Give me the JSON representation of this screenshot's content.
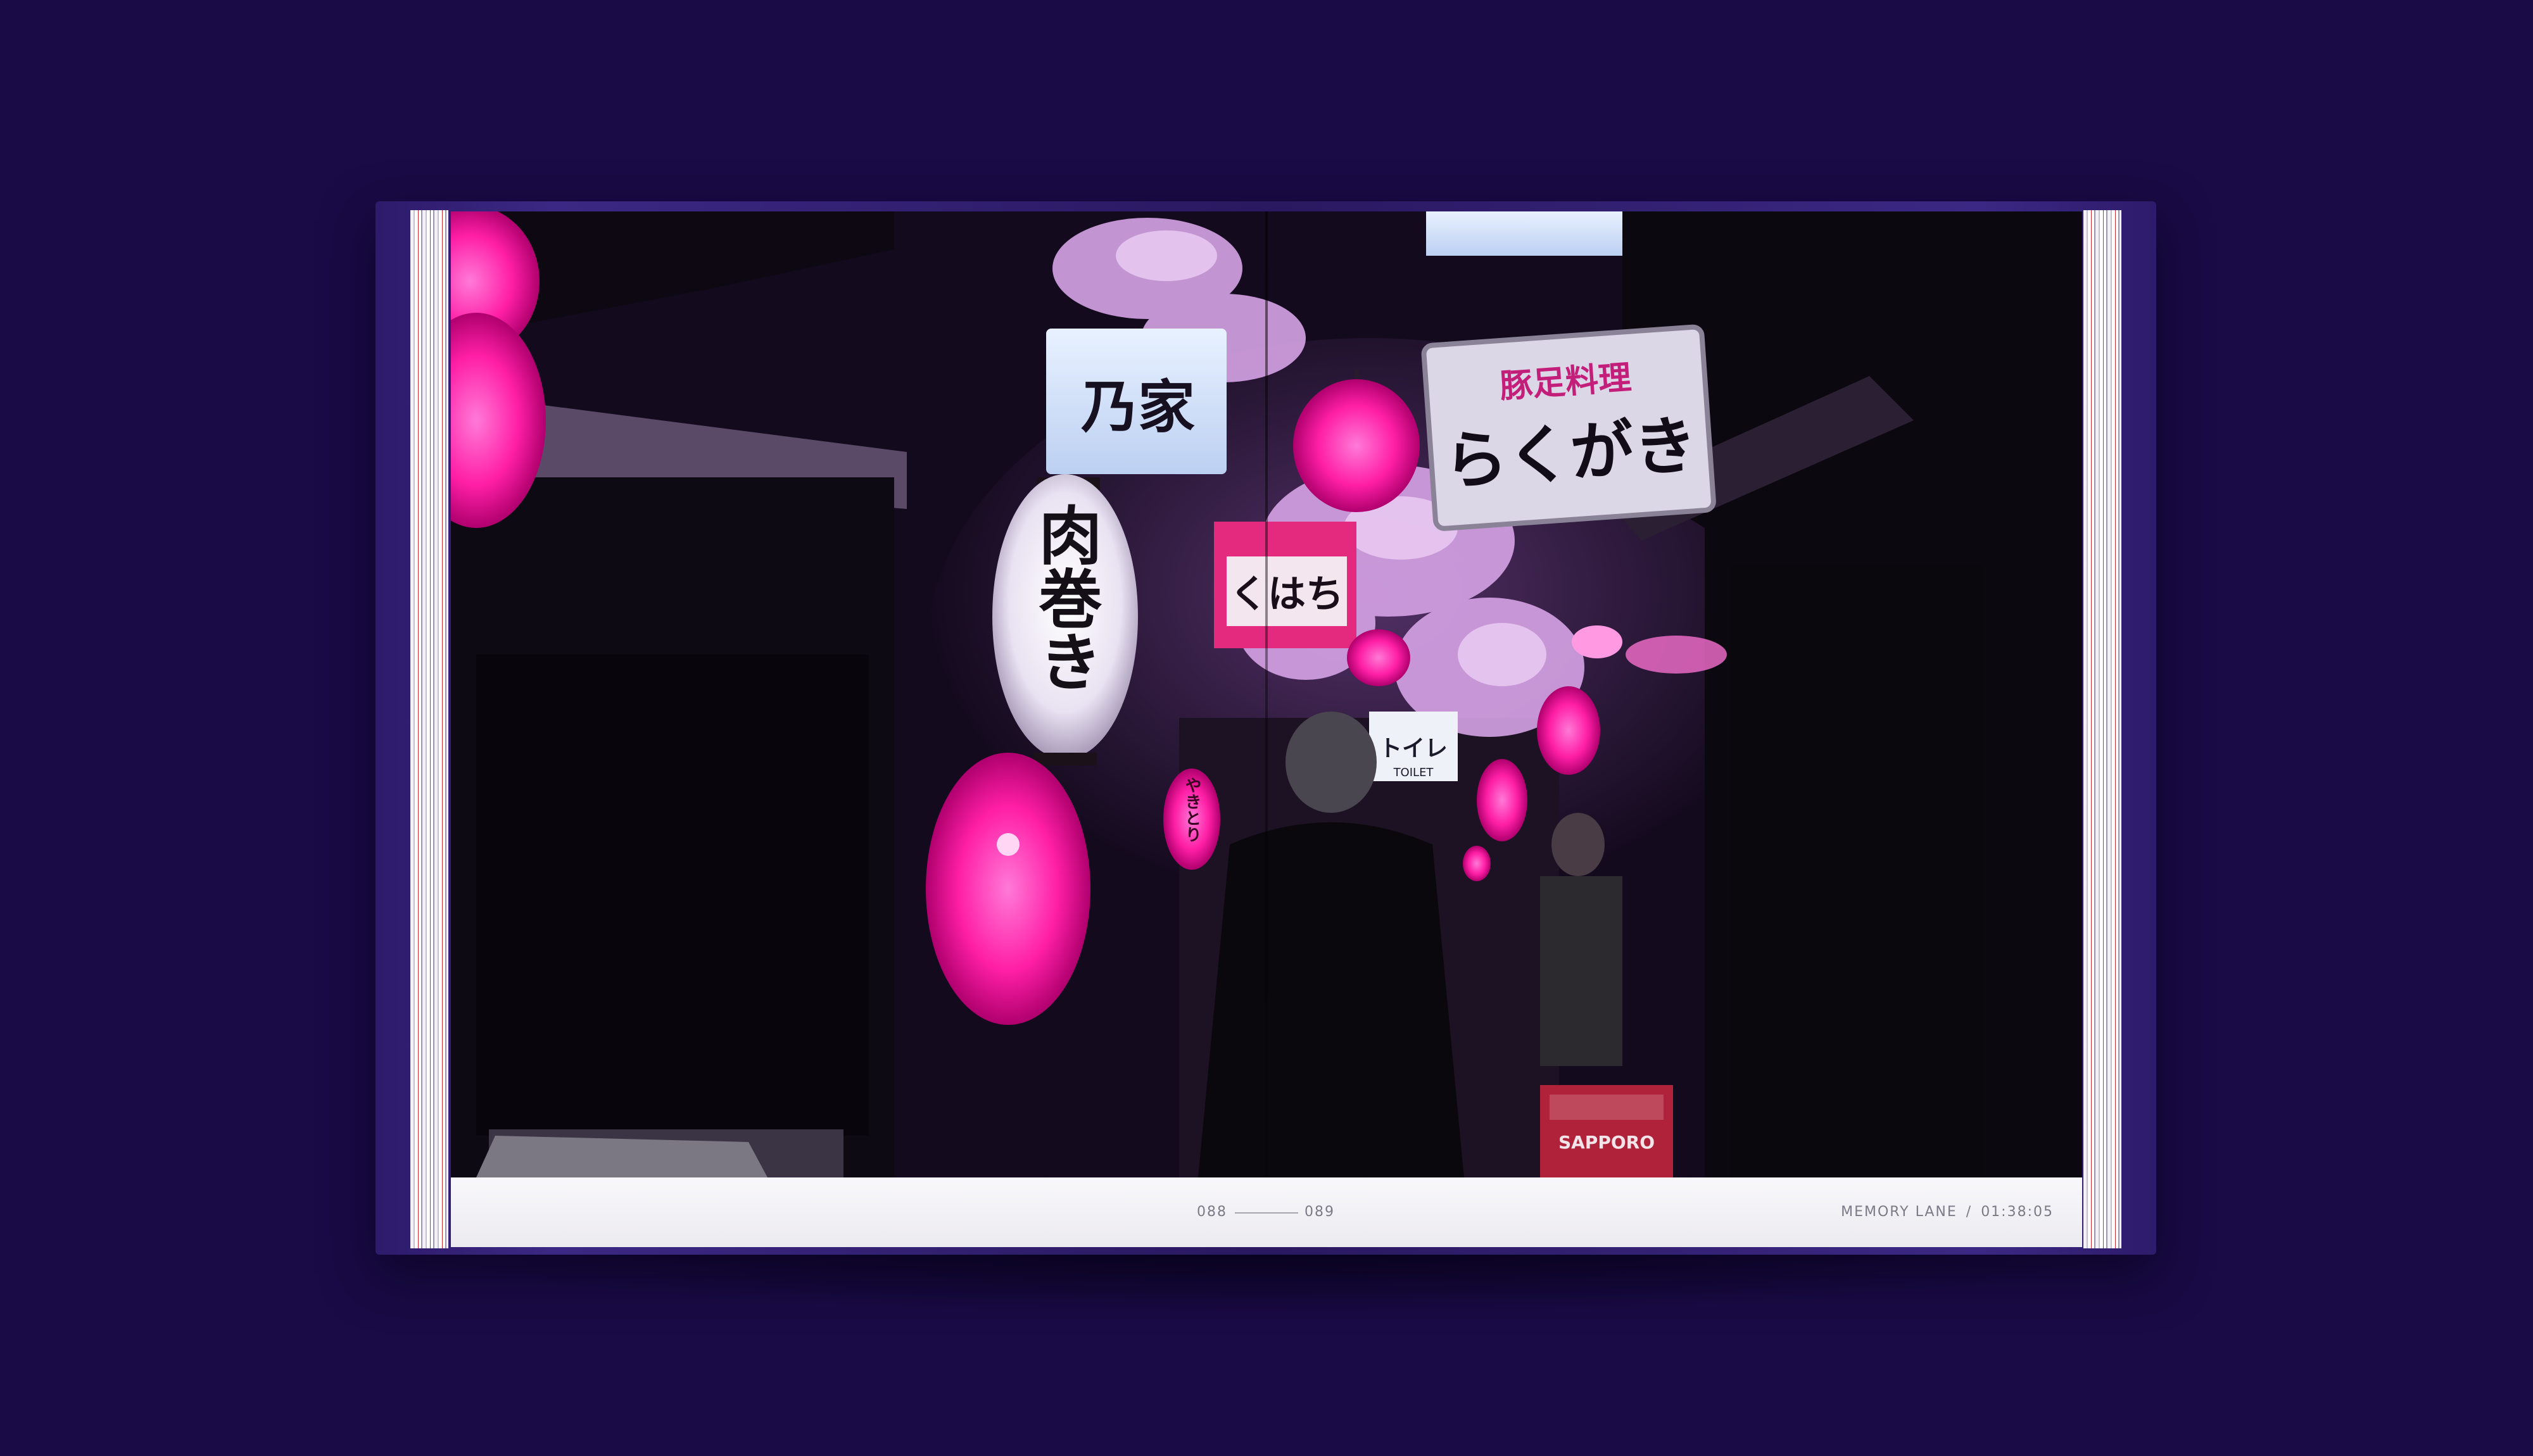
{
  "spread": {
    "page_left": "088",
    "page_right": "089",
    "caption_title": "MEMORY LANE",
    "caption_separator": "/",
    "caption_time": "01:38:05"
  },
  "photo": {
    "sign_left": "乃家",
    "sign_right_top": "豚足料理",
    "sign_right_main": "らくがき",
    "lantern_big": "肉巻き",
    "sign_small": "くはち",
    "sign_toilet": "トイレ",
    "sign_toilet_en": "TOILET",
    "lantern_small_1": "やきとり",
    "crate_brand": "SAPPORO"
  },
  "colors": {
    "background": "#1a0a45",
    "cover": "#3b2884",
    "lantern_pink": "#ff2fb0",
    "footer": "#f4f3f7"
  }
}
